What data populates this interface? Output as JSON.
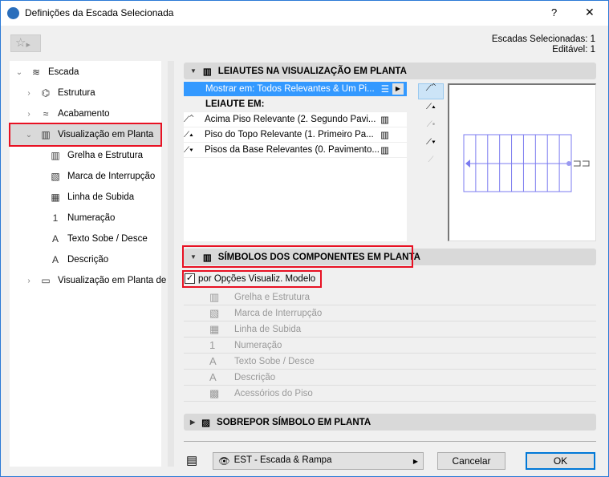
{
  "window": {
    "title": "Definições da Escada Selecionada",
    "help": "?",
    "close": "✕"
  },
  "status": {
    "selected": "Escadas Selecionadas: 1",
    "editable": "Editável: 1"
  },
  "tree": [
    {
      "label": "Escada",
      "icon": "stair-icon",
      "level": 0,
      "chev": "⌄"
    },
    {
      "label": "Estrutura",
      "icon": "structure-icon",
      "level": 1,
      "chev": "›"
    },
    {
      "label": "Acabamento",
      "icon": "finish-icon",
      "level": 1,
      "chev": "›"
    },
    {
      "label": "Visualização em Planta",
      "icon": "floor-plan-icon",
      "level": 1,
      "chev": "⌄",
      "selected": true
    },
    {
      "label": "Grelha e Estrutura",
      "icon": "grid-icon",
      "level": 2
    },
    {
      "label": "Marca de Interrupção",
      "icon": "break-mark-icon",
      "level": 2
    },
    {
      "label": "Linha de Subida",
      "icon": "walking-line-icon",
      "level": 2
    },
    {
      "label": "Numeração",
      "icon": "numbering-icon",
      "level": 2
    },
    {
      "label": "Texto Sobe / Desce",
      "icon": "text-icon",
      "level": 2
    },
    {
      "label": "Descrição",
      "icon": "description-icon",
      "level": 2
    },
    {
      "label": "Visualização em Planta de",
      "icon": "plan-section-icon",
      "level": 1,
      "chev": "›"
    }
  ],
  "sec1": {
    "title": "LEIAUTES NA VISUALIZAÇÃO EM PLANTA",
    "show": "Mostrar em: Todos Relevantes & Um Pi...",
    "layout_header": "LEIAUTE EM:",
    "rows": [
      "Acima Piso Relevante (2. Segundo Pavi...",
      "Piso do Topo Relevante (1. Primeiro Pa...",
      "Pisos da Base Relevantes (0. Pavimento..."
    ]
  },
  "sec2": {
    "title": "SÍMBOLOS DOS COMPONENTES EM PLANTA",
    "checkbox": "por Opções Visualiz. Modelo",
    "checked": true,
    "items": [
      {
        "label": "Grelha e Estrutura",
        "icon": "▥"
      },
      {
        "label": "Marca de Interrupção",
        "icon": "▧"
      },
      {
        "label": "Linha de Subida",
        "icon": "▦"
      },
      {
        "label": "Numeração",
        "icon": "1"
      },
      {
        "label": "Texto Sobe / Desce",
        "icon": "A"
      },
      {
        "label": "Descrição",
        "icon": "A"
      },
      {
        "label": "Acessórios do Piso",
        "icon": "▩"
      }
    ]
  },
  "sec3": {
    "title": "SOBREPOR SÍMBOLO EM PLANTA"
  },
  "footer": {
    "layer": "EST - Escada & Rampa",
    "cancel": "Cancelar",
    "ok": "OK"
  },
  "colors": {
    "accent": "#3399ff",
    "highlight_border": "#e81123",
    "preview_stair": "#7b7bf0"
  }
}
